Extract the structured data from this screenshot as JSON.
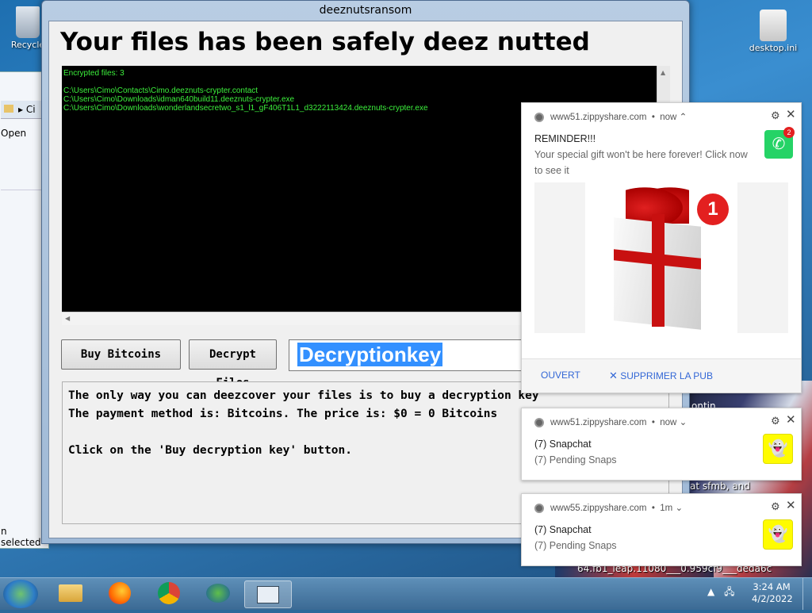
{
  "desktop": {
    "icons": [
      {
        "label": "Recycle"
      },
      {
        "label": "desktop.ini"
      }
    ],
    "wallpaper_text_1": "ontin",
    "wallpaper_text_2": "at sfmb, and",
    "wallpaper_text_3": "64.fb1_leap.11080___0.959cf9___deda6c"
  },
  "explorer": {
    "address": "Ci",
    "open_label": "Open",
    "status": "n selected"
  },
  "window": {
    "title": "deeznutsransom",
    "headline": "Your files has been safely deez nutted",
    "log_lines": [
      "Encrypted files: 3",
      "",
      "C:\\Users\\Cimo\\Contacts\\Cimo.deeznuts-crypter.contact",
      "C:\\Users\\Cimo\\Downloads\\idman640build11.deeznuts-crypter.exe",
      "C:\\Users\\Cimo\\Downloads\\wonderlandsecretwo_s1_l1_gF406T1L1_d3222113424.deeznuts-crypter.exe"
    ],
    "buy_button": "Buy Bitcoins",
    "decrypt_button": "Decrypt Files",
    "key_input_value": "Decryptionkey",
    "message_lines": [
      "The only way you can deezcover your files is to buy a decryption key",
      "The payment method is: Bitcoins.  The price is: $0 = 0 Bitcoins",
      "",
      "Click on the 'Buy decryption key' button."
    ]
  },
  "notifications": [
    {
      "source": "www51.zippyshare.com",
      "time": "now",
      "title": "REMINDER!!!",
      "body": "Your special gift won't be here forever! Click now to see it",
      "app_badge": "2",
      "gift_badge": "1",
      "action_open": "OUVERT",
      "action_remove": "SUPPRIMER LA PUB"
    },
    {
      "source": "www51.zippyshare.com",
      "time": "now",
      "title": "(7) Snapchat",
      "body": "(7) Pending Snaps"
    },
    {
      "source": "www55.zippyshare.com",
      "time": "1m",
      "title": "(7) Snapchat",
      "body": "(7) Pending Snaps"
    }
  ],
  "taskbar": {
    "time": "3:24 AM",
    "date": "4/2/2022"
  },
  "colors": {
    "log_text": "#3cf03c",
    "selection": "#3390ff",
    "link": "#3367d6",
    "whatsapp": "#25d366",
    "snapchat": "#fffc00"
  }
}
